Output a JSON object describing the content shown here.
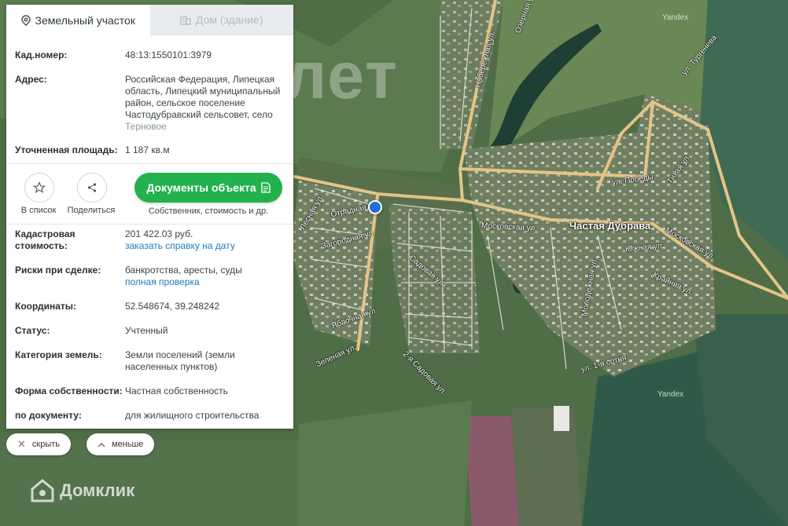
{
  "tabs": [
    {
      "label": "Земельный участок",
      "icon": "location-pin-icon"
    },
    {
      "label": "Дом (здание)",
      "icon": "building-icon"
    }
  ],
  "info": {
    "cadastral_number": {
      "label": "Кад.номер:",
      "value": "48:13:1550101:3979"
    },
    "address": {
      "label": "Адрес:",
      "value": "Российская Федерация, Липецкая область, Липецкий муниципальный район, сельское поселение Частодубравский сельсовет, село",
      "value_extra": "Терновое"
    },
    "area": {
      "label": "Уточненная площадь:",
      "value": "1 187 кв.м"
    }
  },
  "actions": {
    "favorite_label": "В список",
    "share_label": "Поделиться",
    "documents_button": "Документы объекта",
    "documents_sub": "Собственник, стоимость и др."
  },
  "details": {
    "cad_cost": {
      "label": "Кадастровая стоимость:",
      "value": "201 422.03 руб.",
      "link": "заказать справку на дату"
    },
    "risks": {
      "label": "Риски при сделке:",
      "value": "банкротства, аресты, суды",
      "link": "полная проверка"
    },
    "coords": {
      "label": "Координаты:",
      "value": "52.548674, 39.248242"
    },
    "status": {
      "label": "Статус:",
      "value": "Учтенный"
    },
    "category": {
      "label": "Категория земель:",
      "value": "Земли поселений (земли населенных пунктов)"
    },
    "ownership": {
      "label": "Форма собственности:",
      "value": "Частная собственность"
    },
    "by_document": {
      "label": "по документу:",
      "value": "для жилищного строительства"
    }
  },
  "controls": {
    "hide_label": "скрыть",
    "less_label": "меньше"
  },
  "map": {
    "village": "Частая Дубрава",
    "watermark": "лет",
    "yandex": "Yandex",
    "brand": "Домклик",
    "streets": [
      "Отрадная ул.",
      "Загородная ул.",
      "Яблочная ул.",
      "Садовая ул.",
      "Зеленая ул.",
      "Лесная ул.",
      "2-я Садовая ул.",
      "Московская ул.",
      "ул. Победы",
      "Южная ул.",
      "Молодежная ул.",
      "Крайняя ул.",
      "ул. 1-я сотня",
      "Московская ул.",
      "Тихая ул.",
      "Набережная ул.",
      "ул. Тургенева",
      "Озёрная ул."
    ]
  },
  "colors": {
    "accent_green": "#22b14c",
    "link_blue": "#1f7bc1",
    "pin_blue": "#1f6fd6"
  }
}
